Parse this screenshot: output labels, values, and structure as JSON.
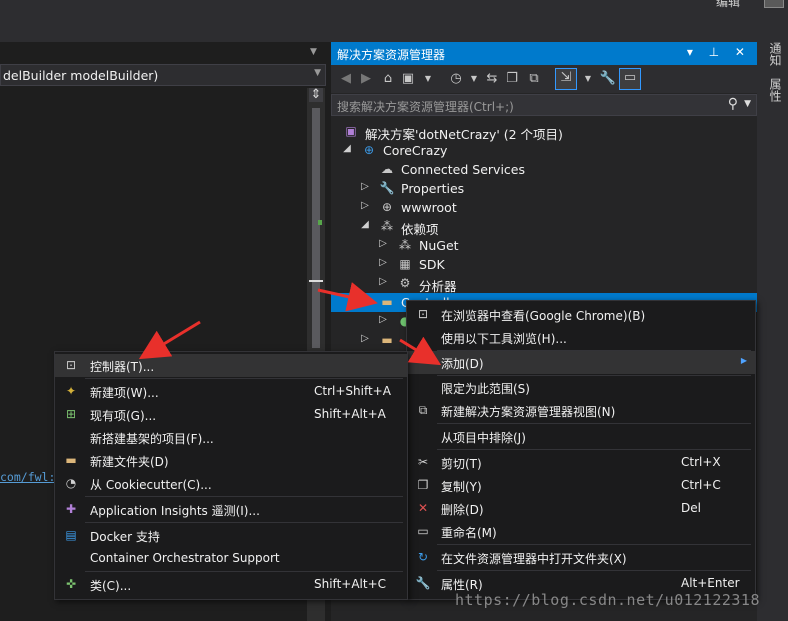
{
  "top": {
    "clipped_text": "编辑"
  },
  "editor": {
    "nav_text": "delBuilder modelBuilder)",
    "link_fragment": "com/fwl:"
  },
  "solution_explorer": {
    "title": "解决方案资源管理器",
    "title_buttons": "▾ ⊥ ✕",
    "search_placeholder": "搜索解决方案资源管理器(Ctrl+;)",
    "tree": [
      {
        "label": "解决方案'dotNetCrazy' (2 个项目)",
        "icon": "solution-icon"
      },
      {
        "label": "CoreCrazy",
        "icon": "web-project-icon"
      },
      {
        "label": "Connected Services",
        "icon": "cloud-icon"
      },
      {
        "label": "Properties",
        "icon": "wrench-icon"
      },
      {
        "label": "wwwroot",
        "icon": "globe-icon"
      },
      {
        "label": "依赖项",
        "icon": "dependencies-icon"
      },
      {
        "label": "NuGet",
        "icon": "nuget-icon"
      },
      {
        "label": "SDK",
        "icon": "sdk-icon"
      },
      {
        "label": "分析器",
        "icon": "analyzer-icon"
      },
      {
        "label": "Controllers",
        "icon": "folder-icon"
      },
      {
        "label": "",
        "icon": "file-icon"
      },
      {
        "label": "",
        "icon": "folder-icon"
      }
    ]
  },
  "right_tabs": [
    "通知",
    "属性"
  ],
  "context_menu": [
    {
      "label": "在浏览器中查看(Google Chrome)(B)",
      "key": "",
      "icon": "browser-icon"
    },
    {
      "label": "使用以下工具浏览(H)...",
      "key": "",
      "icon": ""
    },
    {
      "label": "添加(D)",
      "key": "",
      "icon": ""
    },
    {
      "label": "限定为此范围(S)",
      "key": "",
      "icon": ""
    },
    {
      "label": "新建解决方案资源管理器视图(N)",
      "key": "",
      "icon": "new-view-icon"
    },
    {
      "label": "从项目中排除(J)",
      "key": "",
      "icon": ""
    },
    {
      "label": "剪切(T)",
      "key": "Ctrl+X",
      "icon": "cut-icon"
    },
    {
      "label": "复制(Y)",
      "key": "Ctrl+C",
      "icon": "copy-icon"
    },
    {
      "label": "删除(D)",
      "key": "Del",
      "icon": "delete-icon"
    },
    {
      "label": "重命名(M)",
      "key": "",
      "icon": "rename-icon"
    },
    {
      "label": "在文件资源管理器中打开文件夹(X)",
      "key": "",
      "icon": "open-folder-icon"
    },
    {
      "label": "属性(R)",
      "key": "Alt+Enter",
      "icon": "properties-icon"
    }
  ],
  "submenu": [
    {
      "label": "控制器(T)...",
      "key": "",
      "icon": "controller-icon"
    },
    {
      "label": "新建项(W)...",
      "key": "Ctrl+Shift+A",
      "icon": "new-item-icon"
    },
    {
      "label": "现有项(G)...",
      "key": "Shift+Alt+A",
      "icon": "existing-item-icon"
    },
    {
      "label": "新搭建基架的项目(F)...",
      "key": "",
      "icon": ""
    },
    {
      "label": "新建文件夹(D)",
      "key": "",
      "icon": "new-folder-icon"
    },
    {
      "label": "从 Cookiecutter(C)...",
      "key": "",
      "icon": "cookiecutter-icon"
    },
    {
      "label": "Application Insights 遥测(I)...",
      "key": "",
      "icon": "insights-icon"
    },
    {
      "label": "Docker 支持",
      "key": "",
      "icon": "docker-icon"
    },
    {
      "label": "Container Orchestrator Support",
      "key": "",
      "icon": ""
    },
    {
      "label": "类(C)...",
      "key": "Shift+Alt+C",
      "icon": "class-icon"
    }
  ],
  "watermark": "https://blog.csdn.net/u012122318"
}
